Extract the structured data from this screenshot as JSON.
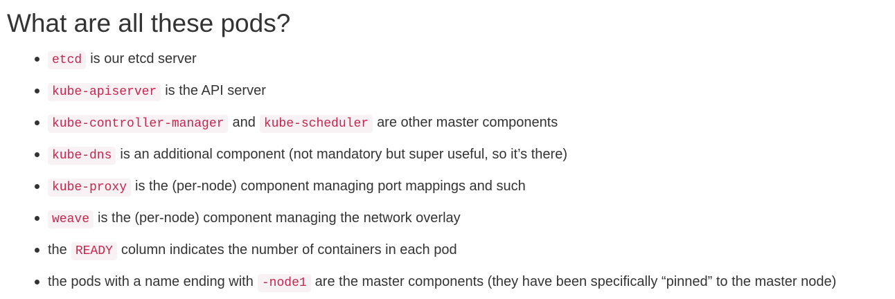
{
  "heading": "What are all these pods?",
  "items": [
    {
      "code1": "etcd",
      "text1": "is our etcd server"
    },
    {
      "code1": "kube-apiserver",
      "text1": "is the API server"
    },
    {
      "code1": "kube-controller-manager",
      "text1": "and",
      "code2": "kube-scheduler",
      "text2": "are other master components"
    },
    {
      "code1": "kube-dns",
      "text1": "is an additional component (not mandatory but super useful, so it’s there)"
    },
    {
      "code1": "kube-proxy",
      "text1": "is the (per-node) component managing port mappings and such"
    },
    {
      "code1": "weave",
      "text1": "is the (per-node) component managing the network overlay"
    },
    {
      "pre": "the",
      "code1": "READY",
      "text1": "column indicates the number of containers in each pod"
    },
    {
      "pre": "the pods with a name ending with",
      "code1": "-node1",
      "text1": "are the master components (they have been specifically “pinned” to the master node)"
    }
  ]
}
